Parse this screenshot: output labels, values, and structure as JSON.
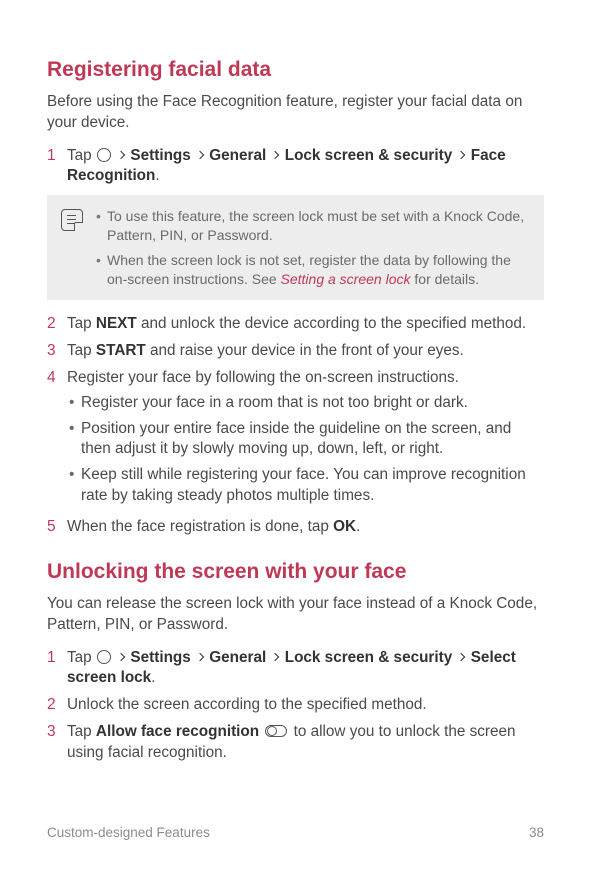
{
  "section1": {
    "heading": "Registering facial data",
    "intro": "Before using the Face Recognition feature, register your facial data on your device.",
    "step1": {
      "tap": "Tap ",
      "settings": "Settings",
      "general": "General",
      "lock": "Lock screen & security",
      "face": "Face Recognition",
      "period": "."
    },
    "note": {
      "item1": "To use this feature, the screen lock must be set with a Knock Code, Pattern, PIN, or Password.",
      "item2_a": "When the screen lock is not set, register the data by following the on-screen instructions. See ",
      "item2_link": "Setting a screen lock",
      "item2_b": " for details."
    },
    "step2_a": "Tap ",
    "step2_bold": "NEXT",
    "step2_b": " and unlock the device according to the specified method.",
    "step3_a": "Tap ",
    "step3_bold": "START",
    "step3_b": " and raise your device in the front of your eyes.",
    "step4": "Register your face by following the on-screen instructions.",
    "step4_b1": "Register your face in a room that is not too bright or dark.",
    "step4_b2": "Position your entire face inside the guideline on the screen, and then adjust it by slowly moving up, down, left, or right.",
    "step4_b3": "Keep still while registering your face. You can improve recognition rate by taking steady photos multiple times.",
    "step5_a": "When the face registration is done, tap ",
    "step5_bold": "OK",
    "step5_b": "."
  },
  "section2": {
    "heading": "Unlocking the screen with your face",
    "intro": "You can release the screen lock with your face instead of a Knock Code, Pattern, PIN, or Password.",
    "step1": {
      "tap": "Tap ",
      "settings": "Settings",
      "general": "General",
      "lock": "Lock screen & security",
      "select": "Select screen lock",
      "period": "."
    },
    "step2": "Unlock the screen according to the specified method.",
    "step3_a": "Tap ",
    "step3_bold": "Allow face recognition",
    "step3_b": " to allow you to unlock the screen using facial recognition."
  },
  "nums": {
    "n1": "1",
    "n2": "2",
    "n3": "3",
    "n4": "4",
    "n5": "5"
  },
  "footer": {
    "left": "Custom-designed Features",
    "right": "38"
  }
}
